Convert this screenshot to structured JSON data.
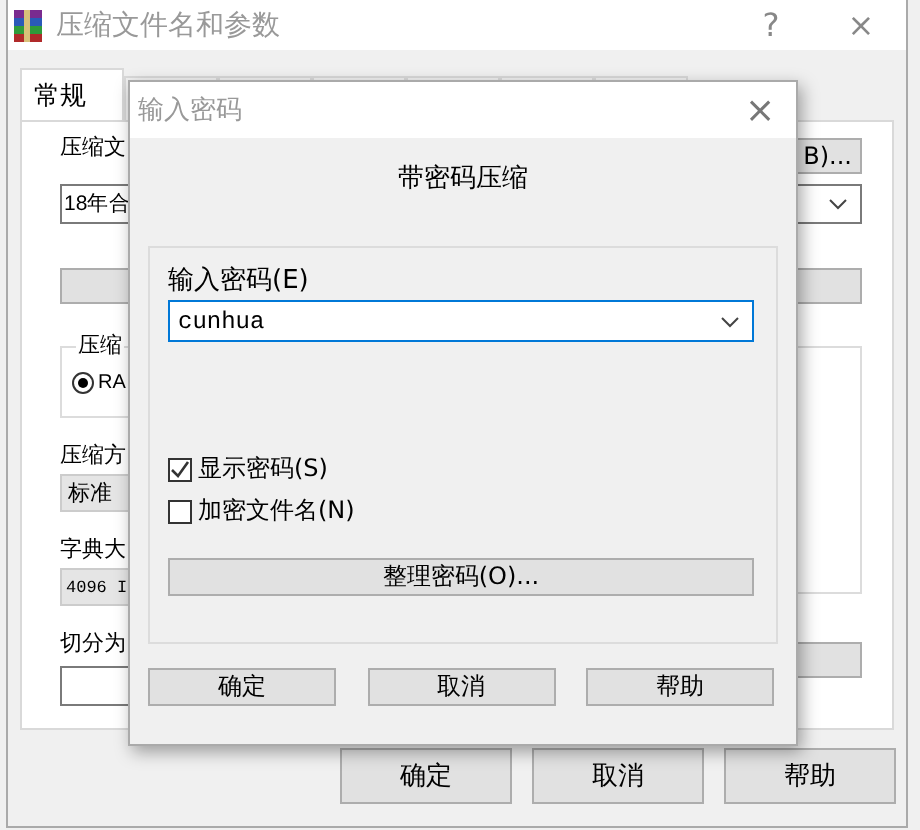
{
  "window": {
    "title": "压缩文件名和参数",
    "help": "?",
    "close": "×"
  },
  "tabs": [
    {
      "label": "常规",
      "selected": true
    }
  ],
  "general": {
    "archive_label": "压缩文",
    "browse_button": "B)...",
    "archive_name": "18年合",
    "format_label": "压缩",
    "format_option": {
      "label": "RA",
      "selected": true
    },
    "method_label": "压缩方",
    "method_value": "标准",
    "dict_label": "字典大",
    "dict_value": "4096 I",
    "split_label": "切分为"
  },
  "buttons": [
    "确定",
    "取消",
    "帮助"
  ],
  "password_dialog": {
    "title": "输入密码",
    "close": "×",
    "heading": "带密码压缩",
    "password_label": "输入密码(E)",
    "password_value": "cunhua",
    "options": [
      {
        "label": "显示密码(S)",
        "checked": true
      },
      {
        "label": "加密文件名(N)",
        "checked": false
      }
    ],
    "organize_button": "整理密码(O)...",
    "buttons": [
      "确定",
      "取消",
      "帮助"
    ]
  }
}
